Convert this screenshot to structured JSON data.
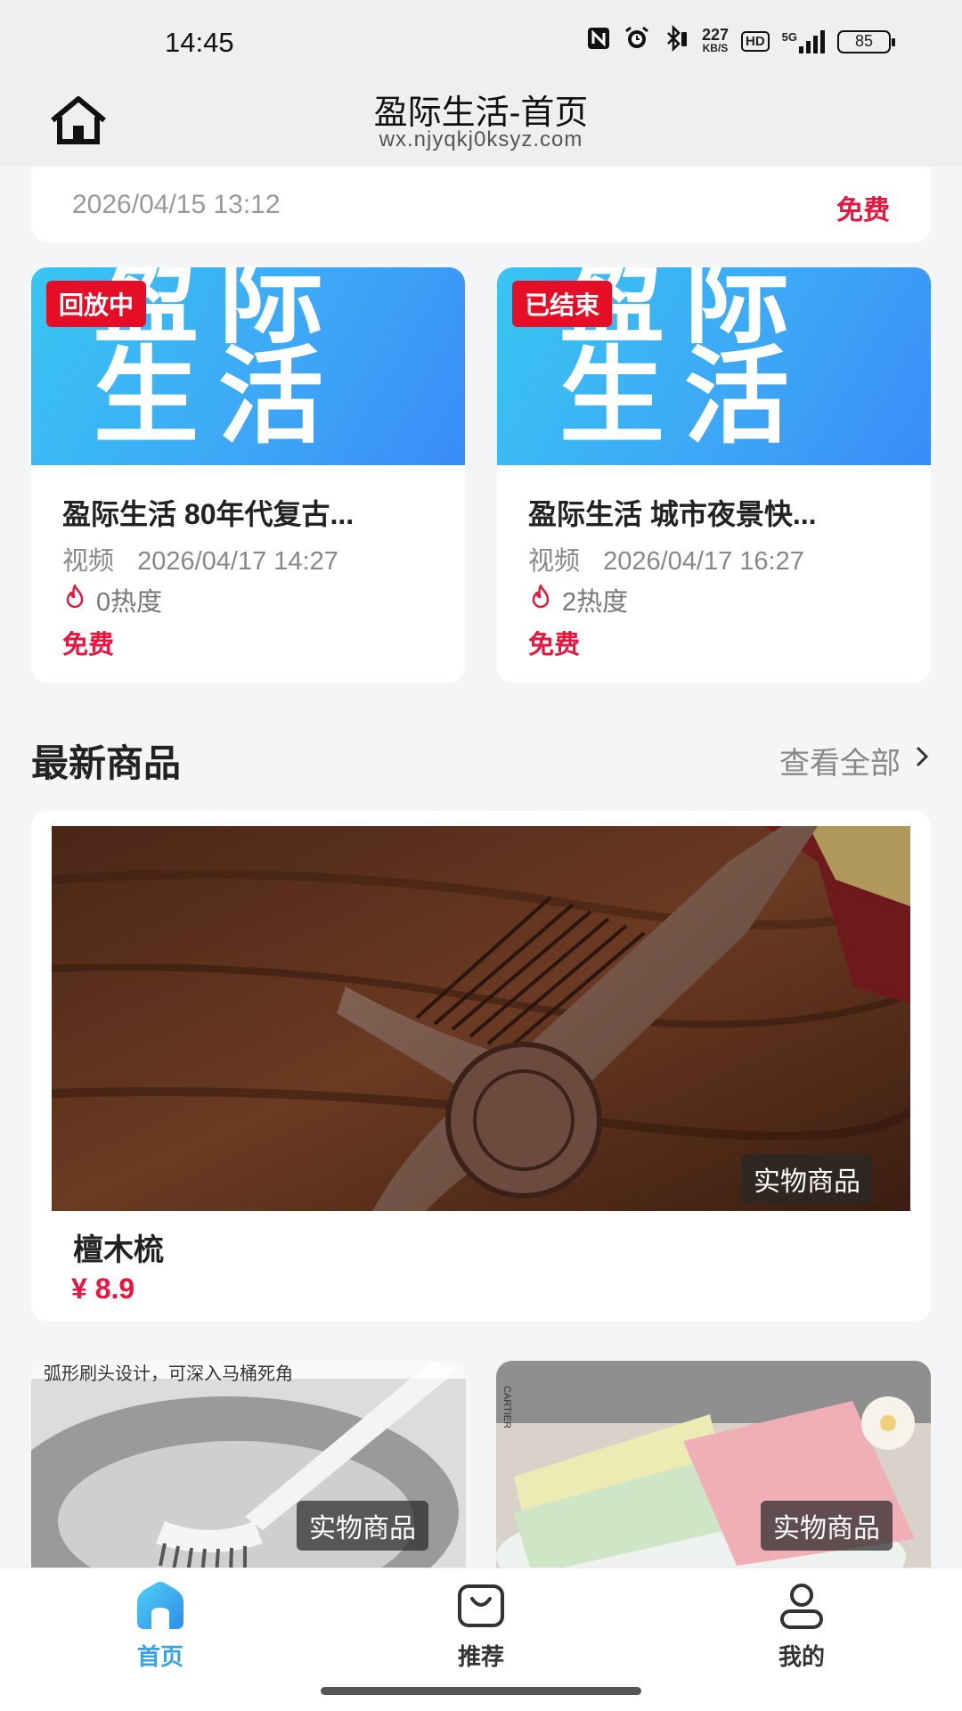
{
  "status_bar": {
    "time": "14:45",
    "net_speed_value": "227",
    "net_speed_unit": "KB/S",
    "hd_label": "HD",
    "network": "5G",
    "battery": "85",
    "icons": [
      "nfc-icon",
      "alarm-icon",
      "bluetooth-icon",
      "hd-icon",
      "signal-icon",
      "battery-icon"
    ]
  },
  "title_bar": {
    "title": "盈际生活-首页",
    "url": "wx.njyqkj0ksyz.com",
    "home_icon": "home-icon"
  },
  "top_card": {
    "date": "2026/04/15 13:12",
    "price": "免费"
  },
  "thumb_art": {
    "line1": "盈际",
    "line2": "生活"
  },
  "videos": [
    {
      "badge": "回放中",
      "title": "盈际生活 80年代复古...",
      "kind": "视频",
      "time": "2026/04/17 14:27",
      "heat": "0热度",
      "price": "免费"
    },
    {
      "badge": "已结束",
      "title": "盈际生活 城市夜景快...",
      "kind": "视频",
      "time": "2026/04/17 16:27",
      "heat": "2热度",
      "price": "免费"
    }
  ],
  "section": {
    "title": "最新商品",
    "see_all": "查看全部"
  },
  "products": [
    {
      "tag": "实物商品",
      "name": "檀木梳",
      "price": "¥ 8.9"
    },
    {
      "tag": "实物商品",
      "caption": "弧形刷头设计，可深入马桶死角"
    },
    {
      "tag": "实物商品",
      "box_text": "CARTIER"
    }
  ],
  "nav": {
    "items": [
      {
        "label": "首页",
        "icon": "home-icon",
        "active": true
      },
      {
        "label": "推荐",
        "icon": "bag-icon",
        "active": false
      },
      {
        "label": "我的",
        "icon": "user-icon",
        "active": false
      }
    ],
    "active_color": "#3aa0e8",
    "inactive_color": "#333333"
  },
  "colors": {
    "price_red": "#e8163f",
    "badge_red": "#e60e26",
    "thumb_blue": "#3da8f6"
  }
}
